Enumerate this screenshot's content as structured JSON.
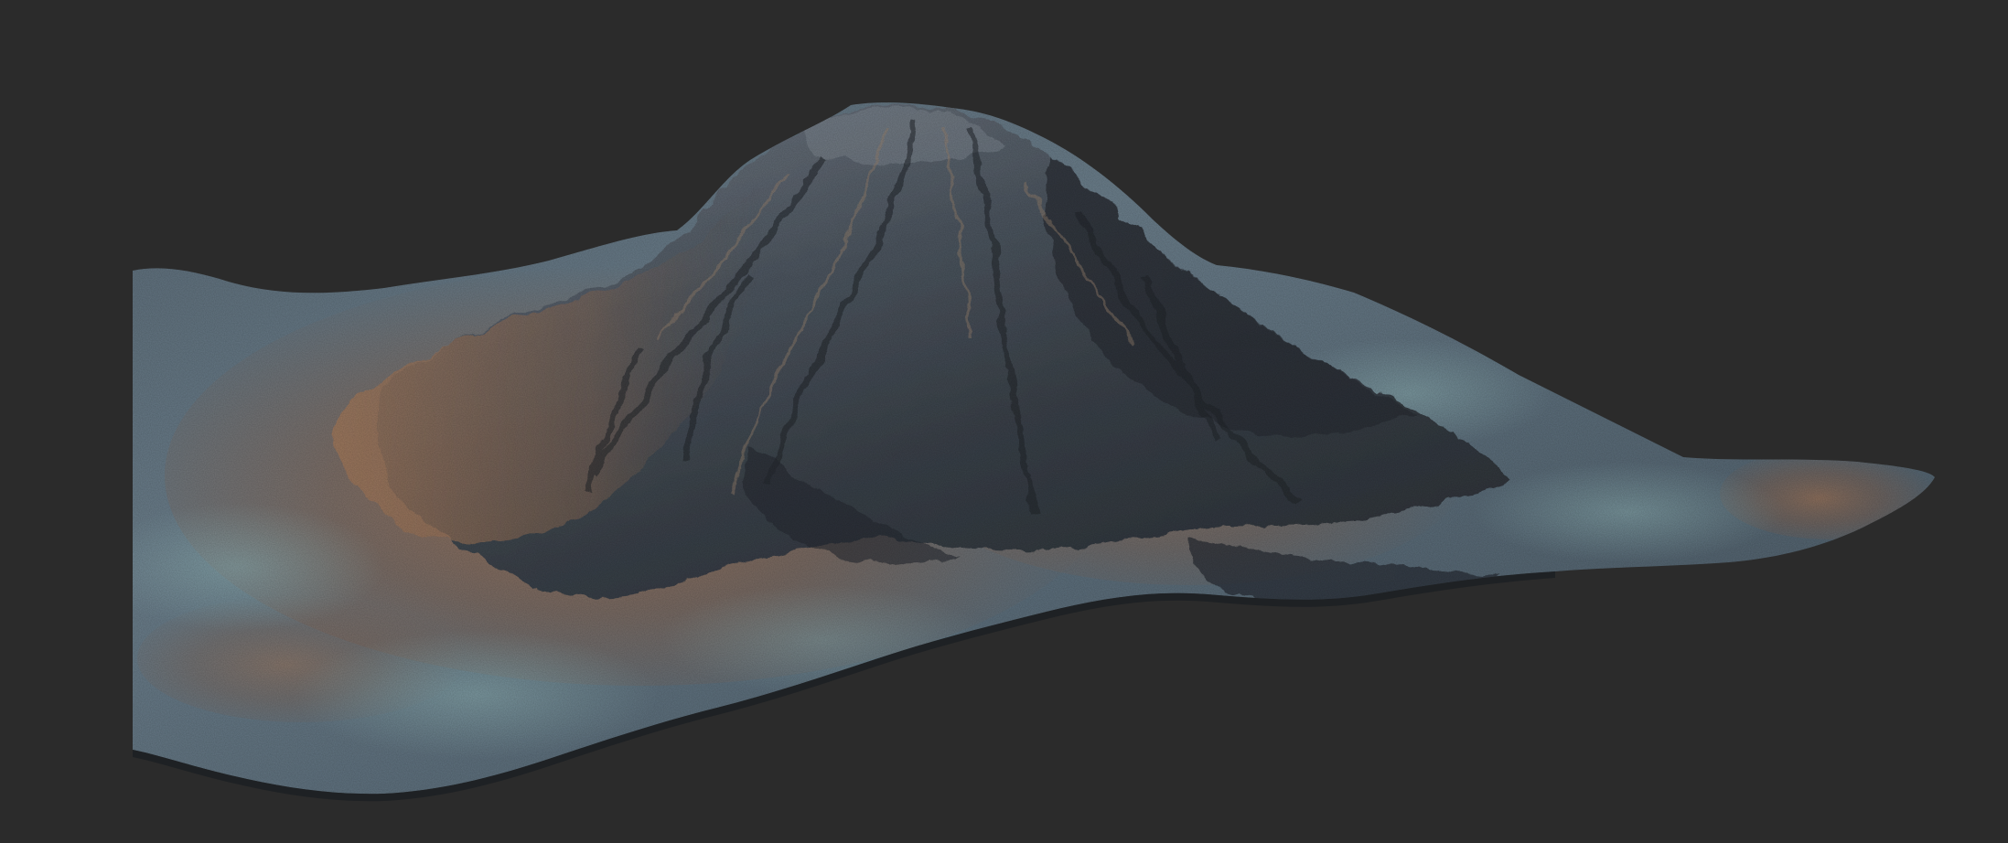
{
  "viewport": {
    "background_color": "#2b2b2b"
  },
  "terrain": {
    "subject": "terrain-mesh",
    "palette": {
      "rock_dark": "#2f3338",
      "rock_mid": "#4d5862",
      "rock_blue": "#6a8394",
      "sediment_teal": "#7fa3a8",
      "soil_orange": "#9a6a4a",
      "soil_light": "#b88a67",
      "shadow": "#1f2226"
    }
  }
}
